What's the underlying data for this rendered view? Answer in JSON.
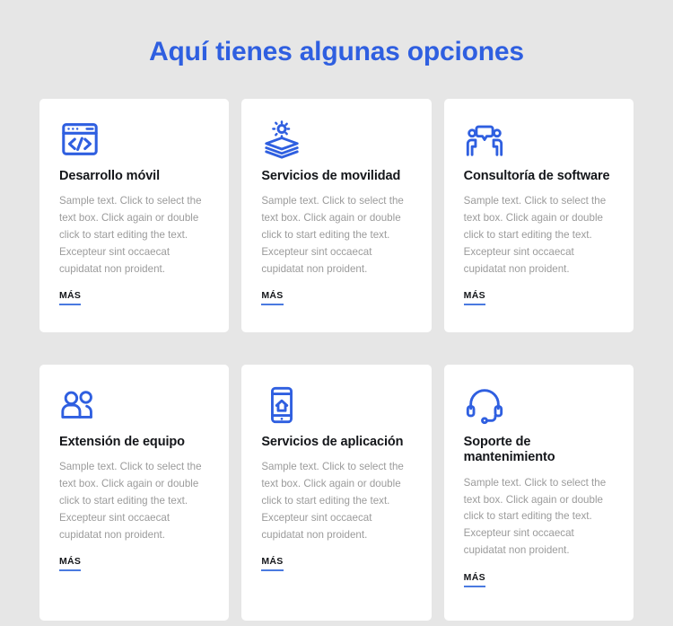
{
  "page": {
    "title": "Aquí tienes algunas opciones",
    "title_color": "#2f5fe0",
    "background_color": "#e6e6e6",
    "card_background_color": "#ffffff",
    "icon_color": "#2f5fe0",
    "link_underline_color": "#4a7ae0",
    "body_text_color": "#9b9b9b"
  },
  "body_text": "Sample text. Click to select the text box. Click again or double click to start editing the text. Excepteur sint occaecat cupidatat non proident.",
  "more_label": "MÁS",
  "cards": [
    {
      "icon": "code-browser-icon",
      "title": "Desarrollo móvil",
      "body": "Sample text. Click to select the text box. Click again or double click to start editing the text. Excepteur sint occaecat cupidatat non proident.",
      "link": "MÁS"
    },
    {
      "icon": "layers-gear-icon",
      "title": "Servicios de movilidad",
      "body": "Sample text. Click to select the text box. Click again or double click to start editing the text. Excepteur sint occaecat cupidatat non proident.",
      "link": "MÁS"
    },
    {
      "icon": "people-speech-bubble-icon",
      "title": "Consultoría de software",
      "body": "Sample text. Click to select the text box. Click again or double click to start editing the text. Excepteur sint occaecat cupidatat non proident.",
      "link": "MÁS"
    },
    {
      "icon": "group-people-icon",
      "title": "Extensión de equipo",
      "body": "Sample text. Click to select the text box. Click again or double click to start editing the text. Excepteur sint occaecat cupidatat non proident.",
      "link": "MÁS"
    },
    {
      "icon": "smartphone-home-icon",
      "title": "Servicios de aplicación",
      "body": "Sample text. Click to select the text box. Click again or double click to start editing the text. Excepteur sint occaecat cupidatat non proident.",
      "link": "MÁS"
    },
    {
      "icon": "headset-support-icon",
      "title": "Soporte de mantenimiento",
      "body": "Sample text. Click to select the text box. Click again or double click to start editing the text. Excepteur sint occaecat cupidatat non proident.",
      "link": "MÁS"
    }
  ]
}
